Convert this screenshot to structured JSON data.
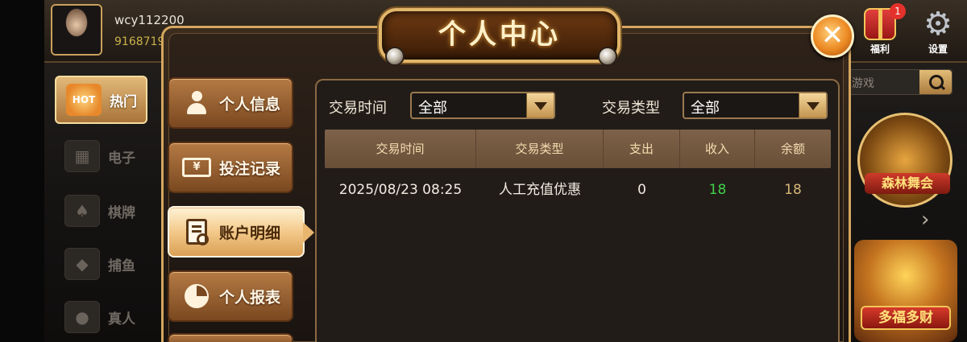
{
  "user": {
    "name": "wcy112200",
    "id": "9168719"
  },
  "lobby": {
    "side_nav": [
      {
        "label": "热门",
        "icon": "hot-flame-icon",
        "badge": "HOT",
        "active": true
      },
      {
        "label": "电子",
        "icon": "slot-machine-icon"
      },
      {
        "label": "棋牌",
        "icon": "playing-card-icon"
      },
      {
        "label": "捕鱼",
        "icon": "fish-icon"
      },
      {
        "label": "真人",
        "icon": "dealer-person-icon"
      }
    ],
    "top_right": {
      "welfare": {
        "label": "福利",
        "badge": "1",
        "icon": "gift-icon"
      },
      "settings": {
        "label": "设置",
        "icon": "gear-icon"
      }
    },
    "search": {
      "placeholder": "游戏"
    },
    "game_tiles": [
      {
        "name": "森林舞会"
      },
      {
        "name": "多福多财"
      }
    ]
  },
  "dialog": {
    "title": "个人中心",
    "close_icon": "close-icon",
    "menu": [
      {
        "label": "个人信息",
        "icon": "person-icon"
      },
      {
        "label": "投注记录",
        "icon": "bill-yen-icon"
      },
      {
        "label": "账户明细",
        "icon": "document-search-icon",
        "active": true
      },
      {
        "label": "个人报表",
        "icon": "pie-chart-icon"
      }
    ],
    "filters": {
      "time_label": "交易时间",
      "time_value": "全部",
      "type_label": "交易类型",
      "type_value": "全部"
    },
    "table": {
      "headers": [
        "交易时间",
        "交易类型",
        "支出",
        "收入",
        "余额"
      ],
      "rows": [
        [
          "2025/08/23 08:25",
          "人工充值优惠",
          "0",
          "18",
          "18"
        ]
      ]
    }
  },
  "colors": {
    "gold_border": "#d4a65e",
    "income_green": "#3fd24a",
    "balance_gold": "#d6b678"
  }
}
